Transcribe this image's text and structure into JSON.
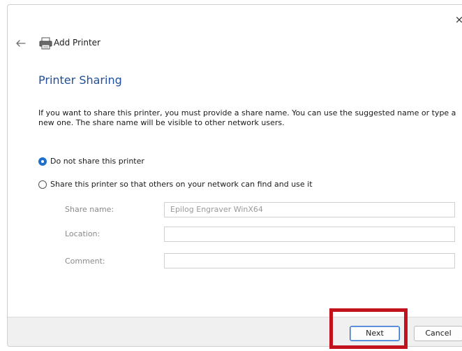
{
  "window": {
    "title": "Add Printer",
    "close_label": "×",
    "back_label": "←"
  },
  "page": {
    "heading": "Printer Sharing",
    "description": "If you want to share this printer, you must provide a share name. You can use the suggested name or type a new one. The share name will be visible to other network users."
  },
  "sharing_options": [
    {
      "label": "Do not share this printer",
      "selected": true
    },
    {
      "label": "Share this printer so that others on your network can find and use it",
      "selected": false
    }
  ],
  "fields": {
    "share_name": {
      "label": "Share name:",
      "value": "Epilog Engraver WinX64"
    },
    "location": {
      "label": "Location:",
      "value": ""
    },
    "comment": {
      "label": "Comment:",
      "value": ""
    }
  },
  "buttons": {
    "next": "Next",
    "cancel": "Cancel"
  },
  "colors": {
    "heading": "#1f4e9c",
    "radio_selected": "#1f6fce",
    "highlight": "#c2121c",
    "footer_bg": "#f0f0f0"
  },
  "icons": {
    "back": "arrow-left-icon",
    "printer": "printer-icon",
    "close": "close-icon"
  }
}
